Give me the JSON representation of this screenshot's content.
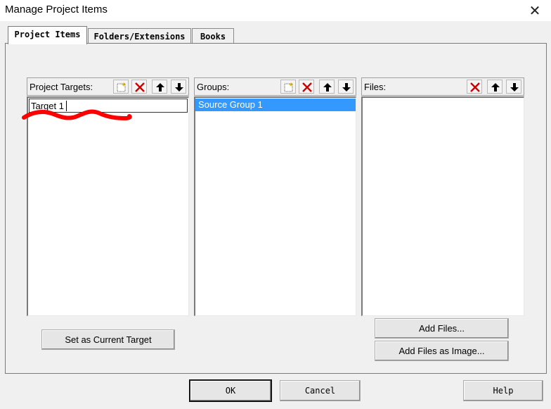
{
  "window": {
    "title": "Manage Project Items",
    "close_glyph": "✕"
  },
  "tabs": [
    {
      "label": "Project Items",
      "active": true
    },
    {
      "label": "Folders/Extensions",
      "active": false
    },
    {
      "label": "Books",
      "active": false
    }
  ],
  "panels": {
    "targets": {
      "label": "Project Targets:",
      "items": [
        {
          "text": "Target 1",
          "editing": true
        }
      ]
    },
    "groups": {
      "label": "Groups:",
      "items": [
        {
          "text": "Source Group 1",
          "selected": true
        }
      ]
    },
    "files": {
      "label": "Files:",
      "items": []
    }
  },
  "buttons": {
    "set_current_target": "Set as Current Target",
    "add_files": "Add Files...",
    "add_files_as_image": "Add Files as Image...",
    "ok": "OK",
    "cancel": "Cancel",
    "help": "Help"
  },
  "icons": {
    "new_item": "new-item-icon",
    "delete": "delete-icon",
    "move_up": "arrow-up-icon",
    "move_down": "arrow-down-icon"
  },
  "colors": {
    "selection": "#3399ff",
    "delete_red": "#cc0000",
    "annotation_red": "#ff0000"
  }
}
